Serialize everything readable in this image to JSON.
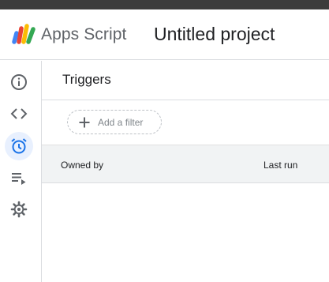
{
  "header": {
    "app_name": "Apps Script",
    "project_title": "Untitled project",
    "logo_colors": [
      "#4285f4",
      "#ea4335",
      "#fbbc04",
      "#34a853"
    ]
  },
  "sidebar": {
    "items": [
      {
        "name": "overview",
        "icon": "info-icon",
        "active": false
      },
      {
        "name": "editor",
        "icon": "code-icon",
        "active": false
      },
      {
        "name": "triggers",
        "icon": "alarm-clock-icon",
        "active": true
      },
      {
        "name": "executions",
        "icon": "playlist-play-icon",
        "active": false
      },
      {
        "name": "settings",
        "icon": "gear-icon",
        "active": false
      }
    ]
  },
  "main": {
    "page_title": "Triggers",
    "filter": {
      "label": "Add a filter",
      "icon": "plus-icon"
    },
    "table": {
      "columns": [
        "Owned by",
        "Last run"
      ]
    }
  },
  "colors": {
    "accent": "#1a73e8",
    "active_bg": "#e8f0fe",
    "icon_gray": "#5f6368"
  }
}
